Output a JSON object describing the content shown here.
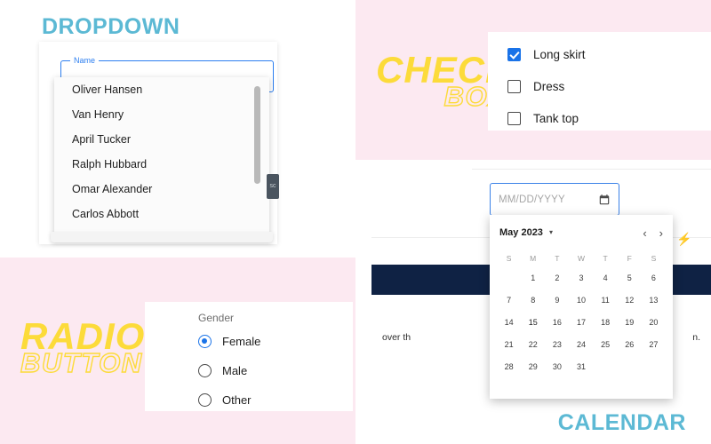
{
  "colors": {
    "teal_title": "#5cb9d4",
    "yellow_title": "#fcdb3a",
    "pink_background": "#fce9f1",
    "accent_blue": "#1a73e8",
    "navy_bar": "#0f2244"
  },
  "sections": {
    "dropdown_title": "DROPDOWN",
    "checkbox_title_solid": "CHECK",
    "checkbox_title_outline": "BOX",
    "radio_title_solid": "RADIO",
    "radio_title_outline": "BUTTON",
    "calendar_title": "CALENDAR"
  },
  "dropdown": {
    "field_label": "Name",
    "field_value": "",
    "options": [
      "Oliver Hansen",
      "Van Henry",
      "April Tucker",
      "Ralph Hubbard",
      "Omar Alexander",
      "Carlos Abbott"
    ],
    "side_badge_text": "sc"
  },
  "checkbox": {
    "items": [
      {
        "label": "Long skirt",
        "checked": true
      },
      {
        "label": "Dress",
        "checked": false
      },
      {
        "label": "Tank top",
        "checked": false
      }
    ]
  },
  "radio": {
    "legend": "Gender",
    "items": [
      {
        "label": "Female",
        "selected": true
      },
      {
        "label": "Male",
        "selected": false
      },
      {
        "label": "Other",
        "selected": false
      }
    ]
  },
  "calendar": {
    "input_placeholder": "MM/DD/YYYY",
    "input_value": "",
    "calendar_icon": "calendar-icon",
    "month_label": "May 2023",
    "caret": "▾",
    "prev_arrow": "‹",
    "next_arrow": "›",
    "day_headers": [
      "S",
      "M",
      "T",
      "W",
      "T",
      "F",
      "S"
    ],
    "leading_blanks": 1,
    "days": [
      1,
      2,
      3,
      4,
      5,
      6,
      7,
      8,
      9,
      10,
      11,
      12,
      13,
      14,
      15,
      16,
      17,
      18,
      19,
      20,
      21,
      22,
      23,
      24,
      25,
      26,
      27,
      28,
      29,
      30,
      31
    ],
    "selected_day": 15,
    "background_text_left": "over th",
    "background_text_right": "n.",
    "bolt_icon": "⚡"
  }
}
